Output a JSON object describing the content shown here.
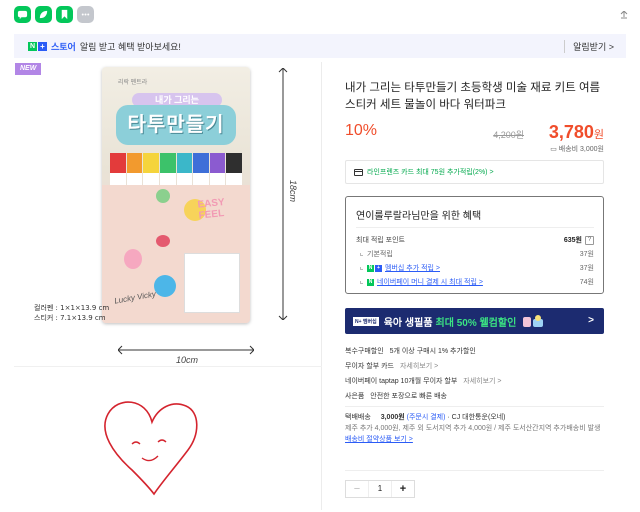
{
  "share": {
    "icons": [
      "chat-icon",
      "leaf-icon",
      "bookmark-icon",
      "more-icon"
    ]
  },
  "notice": {
    "logo_n": "N",
    "logo_plus": "+",
    "store": "스토어",
    "text": "알림 받고 혜택 받아보세요!",
    "alarm_button": "알림받기 >"
  },
  "badge": "NEW",
  "image": {
    "pkg_brand": "리락\n펜트라",
    "pkg_subtitle": "내가 그리는",
    "pkg_title": "타투만들기",
    "easy_text": "EASY FEEL",
    "lucky_text": "Lucky Vicky",
    "dim_height": "18cm",
    "dim_width": "10cm",
    "dims_note_1": "컬러펜 : 1×1×13.9 cm",
    "dims_note_2": "스티커 : 7.1×13.9 cm",
    "marker_colors": [
      "#e33b3b",
      "#f29a2e",
      "#f5d43c",
      "#3cc26a",
      "#3bb7c9",
      "#3e6fd8",
      "#8b5bd0",
      "#2f2f2f"
    ]
  },
  "product": {
    "title": "내가 그리는 타투만들기 초등학생 미술 재료 키트 여름 스티커 세트 물놀이 바다 워터파크",
    "discount": "10%",
    "original_price": "4,200원",
    "price": "3,780",
    "price_unit": "원",
    "shipping_fee": "배송비 3,000원",
    "card_promo": "라인프렌즈 카드 최대 75원 추가적립(2%) >"
  },
  "benefit": {
    "title": "연이룰루랄라님만을 위한 혜택",
    "max_points_label": "최대 적립 포인트",
    "max_points": "635원",
    "rows": [
      {
        "label": "기본적립",
        "amount": "37원"
      },
      {
        "label": "멤버십 추가 적립 >",
        "amount": "37원"
      },
      {
        "label": "네이버페이 머니 결제 시 최대 적립 >",
        "amount": "74원"
      }
    ]
  },
  "banner": {
    "tag": "N+ 멤버십",
    "text": "육아 생필품",
    "highlight": "최대 50% 웰컴할인",
    "arrow": ">"
  },
  "options": [
    {
      "label": "복수구매할인",
      "detail": "5개 이상 구매시 1% 추가할인",
      "more": ""
    },
    {
      "label": "무이자 할부 카드",
      "detail": "",
      "more": "자세히보기 >"
    },
    {
      "label": "네이버페이 taptap 10개월 무이자 할부",
      "detail": "",
      "more": "자세히보기 >"
    },
    {
      "label": "사은품",
      "detail": "안전한 포장으로 빠른 배송",
      "more": ""
    }
  ],
  "shipping": {
    "label": "택배배송",
    "cost": "3,000원",
    "note": "(주문시 결제)",
    "carrier": "· CJ 대한통운(오네)",
    "extra": "제주 추가 4,000원, 제주 외 도서지역 추가 4,000원 / 제주 도서산간지역 추가배송비 발생",
    "bundle_link": "배송비 절약상품 보기 >"
  },
  "quantity": {
    "minus": "−",
    "value": "1",
    "plus": "+"
  }
}
